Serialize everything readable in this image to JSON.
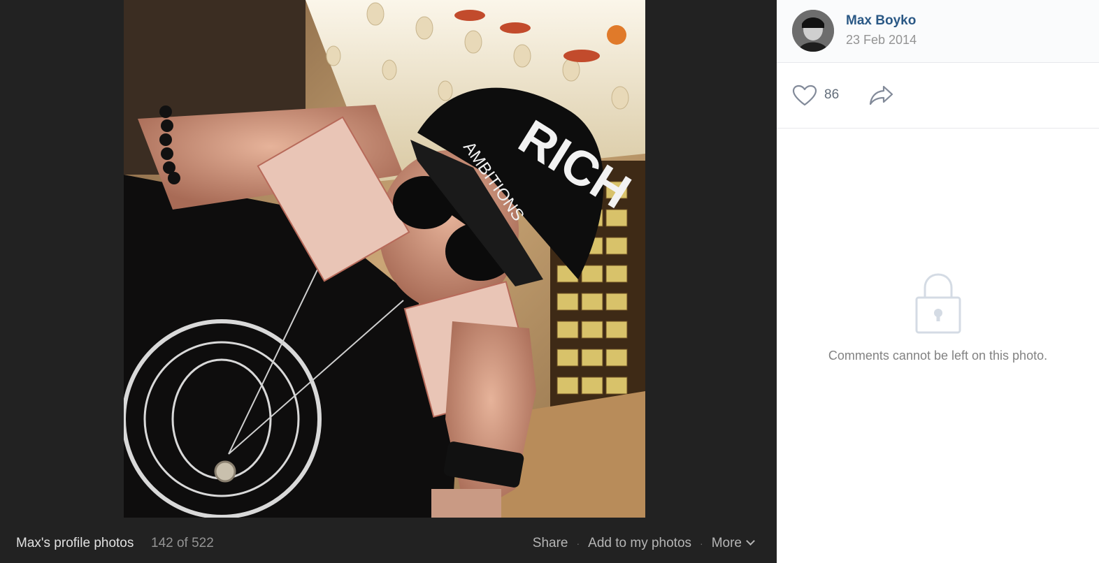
{
  "viewer": {
    "album_title": "Max's profile photos",
    "counter": "142 of 522",
    "actions": {
      "share": "Share",
      "add": "Add to my photos",
      "more": "More"
    }
  },
  "photo": {
    "cap_text_1": "RICH",
    "cap_text_2": "AMBITIONS"
  },
  "sidebar": {
    "author": "Max Boyko",
    "date": "23 Feb 2014",
    "likes": "86",
    "comments_closed": "Comments cannot be left on this photo."
  },
  "colors": {
    "viewer_bg": "#222222",
    "link": "#2a5885",
    "muted": "#939393"
  }
}
